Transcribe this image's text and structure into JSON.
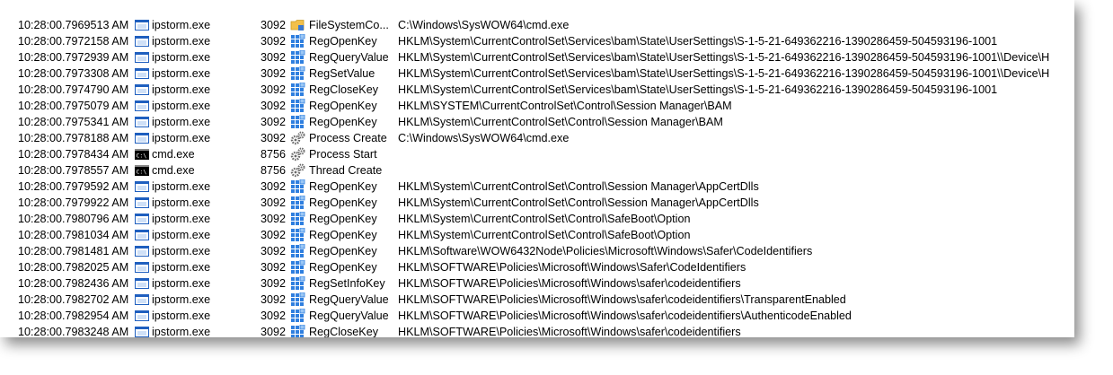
{
  "colors": {
    "exe_blue": "#1f5fbf",
    "registry_blue": "#2f7fdf",
    "folder_yellow": "#f2c04a",
    "gear_gray": "#6a6a6a"
  },
  "rows": [
    {
      "time": "10:28:00.7969513 AM",
      "process": "ipstorm.exe",
      "process_icon": "exe-icon",
      "pid": "3092",
      "op_icon": "filesystem-icon",
      "operation": "FileSystemCo...",
      "path": "C:\\Windows\\SysWOW64\\cmd.exe"
    },
    {
      "time": "10:28:00.7972158 AM",
      "process": "ipstorm.exe",
      "process_icon": "exe-icon",
      "pid": "3092",
      "op_icon": "registry-icon",
      "operation": "RegOpenKey",
      "path": "HKLM\\System\\CurrentControlSet\\Services\\bam\\State\\UserSettings\\S-1-5-21-649362216-1390286459-504593196-1001"
    },
    {
      "time": "10:28:00.7972939 AM",
      "process": "ipstorm.exe",
      "process_icon": "exe-icon",
      "pid": "3092",
      "op_icon": "registry-icon",
      "operation": "RegQueryValue",
      "path": "HKLM\\System\\CurrentControlSet\\Services\\bam\\State\\UserSettings\\S-1-5-21-649362216-1390286459-504593196-1001\\\\Device\\H"
    },
    {
      "time": "10:28:00.7973308 AM",
      "process": "ipstorm.exe",
      "process_icon": "exe-icon",
      "pid": "3092",
      "op_icon": "registry-icon",
      "operation": "RegSetValue",
      "path": "HKLM\\System\\CurrentControlSet\\Services\\bam\\State\\UserSettings\\S-1-5-21-649362216-1390286459-504593196-1001\\\\Device\\H"
    },
    {
      "time": "10:28:00.7974790 AM",
      "process": "ipstorm.exe",
      "process_icon": "exe-icon",
      "pid": "3092",
      "op_icon": "registry-icon",
      "operation": "RegCloseKey",
      "path": "HKLM\\System\\CurrentControlSet\\Services\\bam\\State\\UserSettings\\S-1-5-21-649362216-1390286459-504593196-1001"
    },
    {
      "time": "10:28:00.7975079 AM",
      "process": "ipstorm.exe",
      "process_icon": "exe-icon",
      "pid": "3092",
      "op_icon": "registry-icon",
      "operation": "RegOpenKey",
      "path": "HKLM\\SYSTEM\\CurrentControlSet\\Control\\Session Manager\\BAM"
    },
    {
      "time": "10:28:00.7975341 AM",
      "process": "ipstorm.exe",
      "process_icon": "exe-icon",
      "pid": "3092",
      "op_icon": "registry-icon",
      "operation": "RegOpenKey",
      "path": "HKLM\\System\\CurrentControlSet\\Control\\Session Manager\\BAM"
    },
    {
      "time": "10:28:00.7978188 AM",
      "process": "ipstorm.exe",
      "process_icon": "exe-icon",
      "pid": "3092",
      "op_icon": "gears-icon",
      "operation": "Process Create",
      "path": "C:\\Windows\\SysWOW64\\cmd.exe"
    },
    {
      "time": "10:28:00.7978434 AM",
      "process": "cmd.exe",
      "process_icon": "console-icon",
      "pid": "8756",
      "op_icon": "gears-icon",
      "operation": "Process Start",
      "path": ""
    },
    {
      "time": "10:28:00.7978557 AM",
      "process": "cmd.exe",
      "process_icon": "console-icon",
      "pid": "8756",
      "op_icon": "gears-icon",
      "operation": "Thread Create",
      "path": ""
    },
    {
      "time": "10:28:00.7979592 AM",
      "process": "ipstorm.exe",
      "process_icon": "exe-icon",
      "pid": "3092",
      "op_icon": "registry-icon",
      "operation": "RegOpenKey",
      "path": "HKLM\\System\\CurrentControlSet\\Control\\Session Manager\\AppCertDlls"
    },
    {
      "time": "10:28:00.7979922 AM",
      "process": "ipstorm.exe",
      "process_icon": "exe-icon",
      "pid": "3092",
      "op_icon": "registry-icon",
      "operation": "RegOpenKey",
      "path": "HKLM\\System\\CurrentControlSet\\Control\\Session Manager\\AppCertDlls"
    },
    {
      "time": "10:28:00.7980796 AM",
      "process": "ipstorm.exe",
      "process_icon": "exe-icon",
      "pid": "3092",
      "op_icon": "registry-icon",
      "operation": "RegOpenKey",
      "path": "HKLM\\System\\CurrentControlSet\\Control\\SafeBoot\\Option"
    },
    {
      "time": "10:28:00.7981034 AM",
      "process": "ipstorm.exe",
      "process_icon": "exe-icon",
      "pid": "3092",
      "op_icon": "registry-icon",
      "operation": "RegOpenKey",
      "path": "HKLM\\System\\CurrentControlSet\\Control\\SafeBoot\\Option"
    },
    {
      "time": "10:28:00.7981481 AM",
      "process": "ipstorm.exe",
      "process_icon": "exe-icon",
      "pid": "3092",
      "op_icon": "registry-icon",
      "operation": "RegOpenKey",
      "path": "HKLM\\Software\\WOW6432Node\\Policies\\Microsoft\\Windows\\Safer\\CodeIdentifiers"
    },
    {
      "time": "10:28:00.7982025 AM",
      "process": "ipstorm.exe",
      "process_icon": "exe-icon",
      "pid": "3092",
      "op_icon": "registry-icon",
      "operation": "RegOpenKey",
      "path": "HKLM\\SOFTWARE\\Policies\\Microsoft\\Windows\\Safer\\CodeIdentifiers"
    },
    {
      "time": "10:28:00.7982436 AM",
      "process": "ipstorm.exe",
      "process_icon": "exe-icon",
      "pid": "3092",
      "op_icon": "registry-icon",
      "operation": "RegSetInfoKey",
      "path": "HKLM\\SOFTWARE\\Policies\\Microsoft\\Windows\\safer\\codeidentifiers"
    },
    {
      "time": "10:28:00.7982702 AM",
      "process": "ipstorm.exe",
      "process_icon": "exe-icon",
      "pid": "3092",
      "op_icon": "registry-icon",
      "operation": "RegQueryValue",
      "path": "HKLM\\SOFTWARE\\Policies\\Microsoft\\Windows\\safer\\codeidentifiers\\TransparentEnabled"
    },
    {
      "time": "10:28:00.7982954 AM",
      "process": "ipstorm.exe",
      "process_icon": "exe-icon",
      "pid": "3092",
      "op_icon": "registry-icon",
      "operation": "RegQueryValue",
      "path": "HKLM\\SOFTWARE\\Policies\\Microsoft\\Windows\\safer\\codeidentifiers\\AuthenticodeEnabled"
    },
    {
      "time": "10:28:00.7983248 AM",
      "process": "ipstorm.exe",
      "process_icon": "exe-icon",
      "pid": "3092",
      "op_icon": "registry-icon",
      "operation": "RegCloseKey",
      "path": "HKLM\\SOFTWARE\\Policies\\Microsoft\\Windows\\safer\\codeidentifiers"
    }
  ]
}
